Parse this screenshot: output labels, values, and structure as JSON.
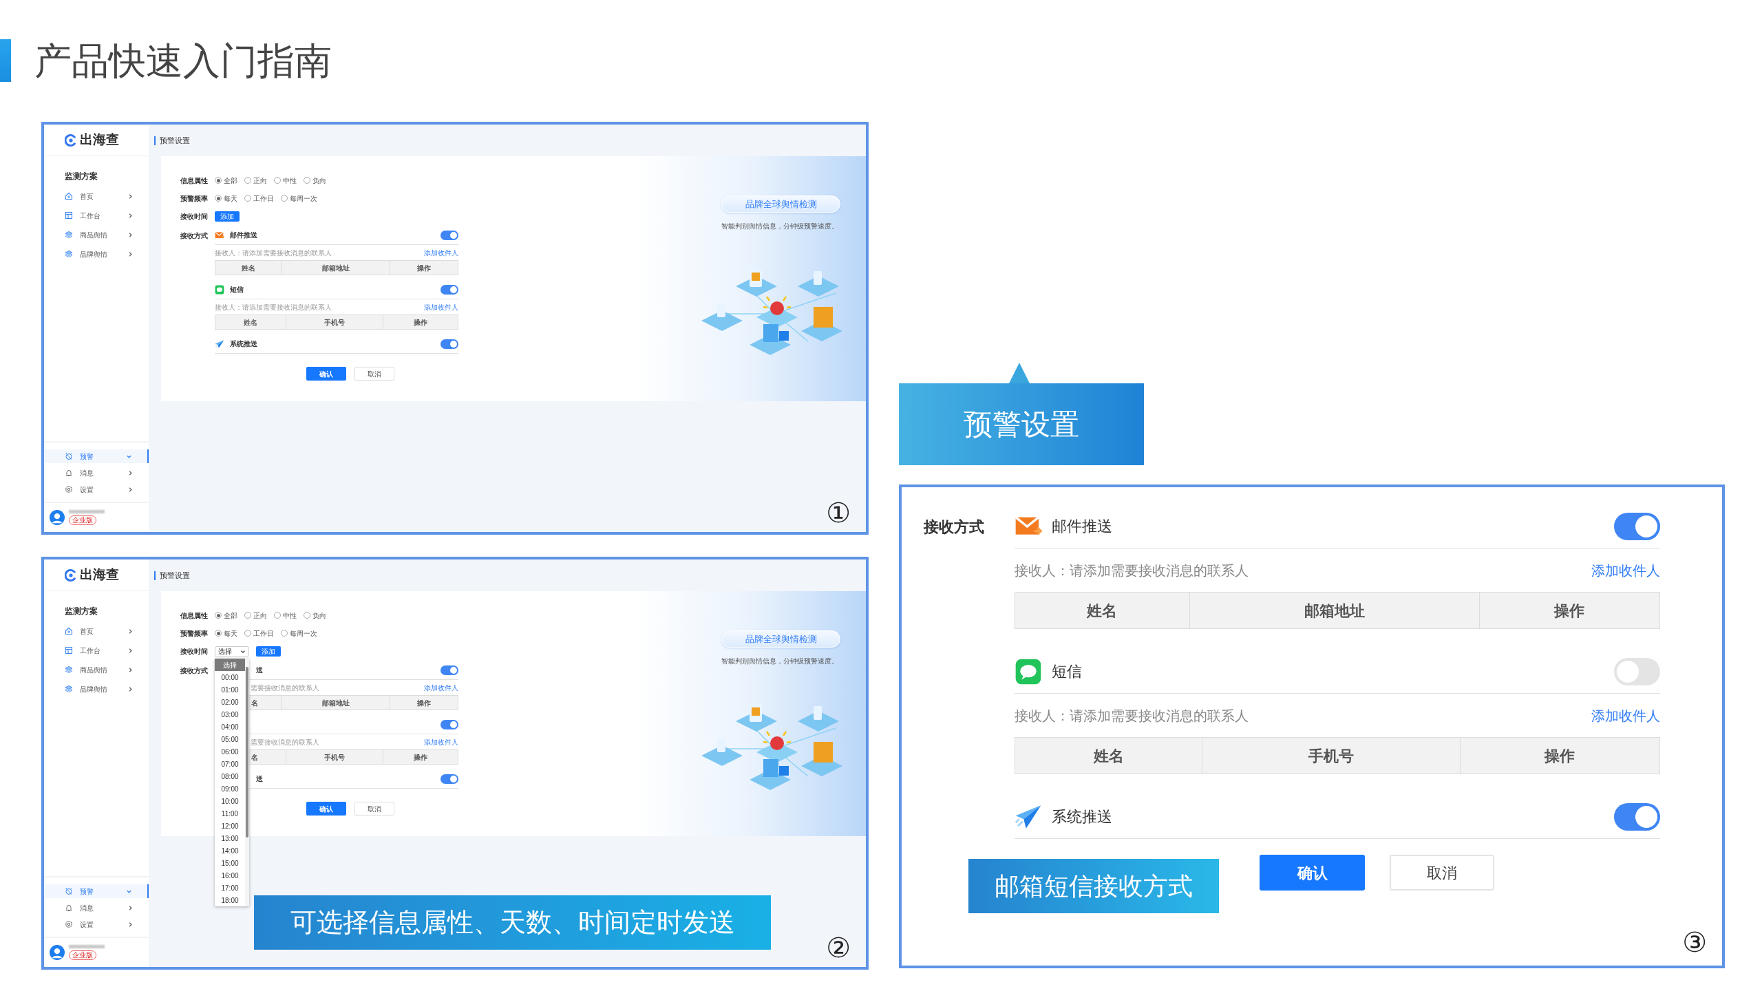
{
  "page_title": "产品快速入门指南",
  "screens": [
    {
      "number": "①",
      "logo": "出海查",
      "header": "预警设置",
      "sidebar": {
        "heading": "监测方案",
        "items": [
          {
            "kind": "home",
            "label": "首页",
            "selected": false
          },
          {
            "kind": "layout",
            "label": "工作台",
            "selected": false
          },
          {
            "kind": "layers",
            "label": "商品舆情",
            "selected": false
          },
          {
            "kind": "layers",
            "label": "品牌舆情",
            "selected": false
          }
        ],
        "bottom_items": [
          {
            "kind": "alarm",
            "label": "预警",
            "selected": true
          },
          {
            "kind": "bell",
            "label": "消息",
            "selected": false
          },
          {
            "kind": "gear",
            "label": "设置",
            "selected": false
          }
        ],
        "badge": "企业版"
      },
      "form": {
        "rows": [
          {
            "label": "信息属性",
            "options": [
              {
                "label": "全部",
                "selected": true
              },
              {
                "label": "正向",
                "selected": false
              },
              {
                "label": "中性",
                "selected": false
              },
              {
                "label": "负向",
                "selected": false
              }
            ]
          },
          {
            "label": "预警频率",
            "options": [
              {
                "label": "每天",
                "selected": true
              },
              {
                "label": "工作日",
                "selected": false
              },
              {
                "label": "每周一次",
                "selected": false
              }
            ]
          }
        ],
        "time": {
          "label": "接收时间",
          "button": "添加"
        },
        "channels_label": "接收方式",
        "channels": [
          {
            "kind": "mail",
            "name": "邮件推送",
            "on": true,
            "note": "接收人：请添加需要接收消息的联系人",
            "link": "添加收件人",
            "columns": [
              "姓名",
              "邮箱地址",
              "操作"
            ]
          },
          {
            "kind": "sms",
            "name": "短信",
            "on": true,
            "note": "接收人：请添加需要接收消息的联系人",
            "link": "添加收件人",
            "columns": [
              "姓名",
              "手机号",
              "操作"
            ]
          },
          {
            "kind": "system",
            "name": "系统推送",
            "on": true
          }
        ],
        "confirm": "确认",
        "cancel": "取消"
      },
      "promo": {
        "title": "品牌全球舆情检测",
        "subtitle": "智能判别舆情信息，分钟级预警速度。"
      }
    },
    {
      "number": "②",
      "logo": "出海查",
      "header": "预警设置",
      "sidebar": {
        "heading": "监测方案",
        "items": [
          {
            "kind": "home",
            "label": "首页",
            "selected": false
          },
          {
            "kind": "layout",
            "label": "工作台",
            "selected": false
          },
          {
            "kind": "layers",
            "label": "商品舆情",
            "selected": false
          },
          {
            "kind": "layers",
            "label": "品牌舆情",
            "selected": false
          }
        ],
        "bottom_items": [
          {
            "kind": "alarm",
            "label": "预警",
            "selected": true
          },
          {
            "kind": "bell",
            "label": "消息",
            "selected": false
          },
          {
            "kind": "gear",
            "label": "设置",
            "selected": false
          }
        ],
        "badge": "企业版"
      },
      "form": {
        "rows": [
          {
            "label": "信息属性",
            "options": [
              {
                "label": "全部",
                "selected": true
              },
              {
                "label": "正向",
                "selected": false
              },
              {
                "label": "中性",
                "selected": false
              },
              {
                "label": "负向",
                "selected": false
              }
            ]
          },
          {
            "label": "预警频率",
            "options": [
              {
                "label": "每天",
                "selected": true
              },
              {
                "label": "工作日",
                "selected": false
              },
              {
                "label": "每周一次",
                "selected": false
              }
            ]
          }
        ],
        "time": {
          "label": "接收时间",
          "select": "选择",
          "button": "添加"
        },
        "channels_label": "接收方式",
        "channels": [
          {
            "name": "送",
            "on": true,
            "note": "需要接收消息的联系人",
            "link": "添加收件人",
            "columns": [
              "名",
              "邮箱地址",
              "操作"
            ]
          },
          {
            "on": true,
            "note": "需要接收消息的联系人",
            "link": "添加收件人",
            "columns": [
              "名",
              "手机号",
              "操作"
            ]
          },
          {
            "name": "送",
            "on": true
          }
        ],
        "dropdown": [
          {
            "label": "选择",
            "selected": true
          },
          {
            "label": "00:00",
            "selected": false
          },
          {
            "label": "01:00",
            "selected": false
          },
          {
            "label": "02:00",
            "selected": false
          },
          {
            "label": "03:00",
            "selected": false
          },
          {
            "label": "04:00",
            "selected": false
          },
          {
            "label": "05:00",
            "selected": false
          },
          {
            "label": "06:00",
            "selected": false
          },
          {
            "label": "07:00",
            "selected": false
          },
          {
            "label": "08:00",
            "selected": false
          },
          {
            "label": "09:00",
            "selected": false
          },
          {
            "label": "10:00",
            "selected": false
          },
          {
            "label": "11:00",
            "selected": false
          },
          {
            "label": "12:00",
            "selected": false
          },
          {
            "label": "13:00",
            "selected": false
          },
          {
            "label": "14:00",
            "selected": false
          },
          {
            "label": "15:00",
            "selected": false
          },
          {
            "label": "16:00",
            "selected": false
          },
          {
            "label": "17:00",
            "selected": false
          },
          {
            "label": "18:00",
            "selected": false
          }
        ],
        "confirm": "确认",
        "cancel": "取消"
      },
      "promo": {
        "title": "品牌全球舆情检测",
        "subtitle": "智能判别舆情信息，分钟级预警速度。"
      },
      "caption": "可选择信息属性、天数、时间定时发送"
    }
  ],
  "callout": "预警设置",
  "panel": {
    "channels_label": "接收方式",
    "channels": [
      {
        "kind": "mail",
        "name": "邮件推送",
        "on": true,
        "note": "接收人：请添加需要接收消息的联系人",
        "link": "添加收件人",
        "columns": [
          "姓名",
          "邮箱地址",
          "操作"
        ]
      },
      {
        "kind": "sms",
        "name": "短信",
        "on": false,
        "note": "接收人：请添加需要接收消息的联系人",
        "link": "添加收件人",
        "columns": [
          "姓名",
          "手机号",
          "操作"
        ]
      },
      {
        "kind": "system",
        "name": "系统推送",
        "on": true
      }
    ],
    "caption": "邮箱短信接收方式",
    "confirm": "确认",
    "cancel": "取消",
    "number": "③"
  }
}
